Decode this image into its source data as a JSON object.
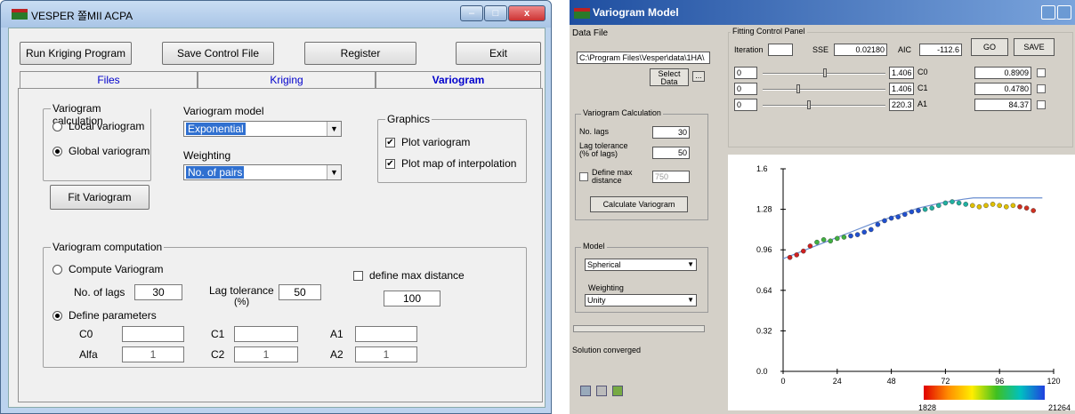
{
  "left_window": {
    "title": "VESPER 쫄MII ACPA",
    "title_controls": {
      "minimize": "–",
      "maximize": "□",
      "close": "x"
    },
    "toolbar": {
      "run_label": "Run Kriging Program",
      "save_label": "Save Control File",
      "register_label": "Register",
      "exit_label": "Exit"
    },
    "tabs": [
      {
        "label": "Files",
        "active": false
      },
      {
        "label": "Kriging",
        "active": false
      },
      {
        "label": "Variogram",
        "active": true
      }
    ],
    "variogram_calc": {
      "legend": "Variogram calculation",
      "local_label": "Local variogram",
      "global_label": "Global variogram",
      "selected": "global"
    },
    "model": {
      "label": "Variogram model",
      "value": "Exponential"
    },
    "weighting": {
      "label": "Weighting",
      "value": "No. of pairs"
    },
    "graphics": {
      "legend": "Graphics",
      "plot_variogram": "Plot variogram",
      "plot_map": "Plot map of interpolation",
      "plot_variogram_checked": true,
      "plot_map_checked": true
    },
    "fit_label": "Fit Variogram",
    "computation": {
      "legend": "Variogram computation",
      "compute_label": "Compute Variogram",
      "nlags_label": "No. of lags",
      "nlags_value": "30",
      "lagtol_label": "Lag tolerance",
      "lagtol_unit": "(%)",
      "lagtol_value": "50",
      "maxdist_label": "define max distance",
      "maxdist_value": "100",
      "define_label": "Define parameters",
      "selected": "define",
      "c0_label": "C0",
      "c0_value": "",
      "c1_label": "C1",
      "c1_value": "",
      "a1_label": "A1",
      "a1_value": "",
      "alfa_label": "Alfa",
      "alfa_value": "1",
      "c2_label": "C2",
      "c2_value": "1",
      "a2_label": "A2",
      "a2_value": "1"
    }
  },
  "right_window": {
    "title": "Variogram Model",
    "data_file": {
      "label": "Data File",
      "path": "C:\\Program Files\\Vesper\\data\\1HA\\",
      "select_label": "Select Data",
      "browse_label": "..."
    },
    "fitting": {
      "legend": "Fitting Control Panel",
      "iteration_label": "Iteration",
      "iteration_value": "",
      "sse_label": "SSE",
      "sse_value": "0.02180",
      "aic_label": "AIC",
      "aic_value": "-112.6",
      "go_label": "GO",
      "save_label": "SAVE",
      "rows": [
        {
          "min": "0",
          "max": "1.406",
          "name": "C0",
          "value": "0.8909",
          "slider": 0.52
        },
        {
          "min": "0",
          "max": "1.406",
          "name": "C1",
          "value": "0.4780",
          "slider": 0.28
        },
        {
          "min": "0",
          "max": "220.3",
          "name": "A1",
          "value": "84.37",
          "slider": 0.38
        }
      ]
    },
    "calc": {
      "legend": "Variogram Calculation",
      "nlags_label": "No. lags",
      "nlags_value": "30",
      "lagtol_label": "Lag tolerance (% of lags)",
      "lagtol_value": "50",
      "maxdist_label": "Define max distance",
      "maxdist_value": "750",
      "calc_label": "Calculate Variogram"
    },
    "model": {
      "legend": "Model",
      "model_value": "Spherical",
      "weighting_label": "Weighting",
      "weighting_value": "Unity"
    },
    "status": "Solution converged",
    "colorbar": {
      "min_label": "1828",
      "max_label": "21264"
    }
  },
  "chart_data": {
    "type": "scatter",
    "title": "",
    "xlabel": "",
    "ylabel": "",
    "xlim": [
      0,
      120
    ],
    "ylim": [
      0,
      1.6
    ],
    "x_ticks": [
      "0",
      "24",
      "48",
      "72",
      "96",
      "120"
    ],
    "y_ticks": [
      "0.0",
      "0.32",
      "0.64",
      "0.96",
      "1.28",
      "1.6"
    ],
    "series": [
      {
        "type": "scatter",
        "x": [
          3,
          6,
          9,
          12,
          15,
          18,
          21,
          24,
          27,
          30,
          33,
          36,
          39,
          42,
          45,
          48,
          51,
          54,
          57,
          60,
          63,
          66,
          69,
          72,
          75,
          78,
          81,
          84,
          87,
          90,
          93,
          96,
          99,
          102,
          105,
          108,
          111
        ],
        "y": [
          0.9,
          0.92,
          0.95,
          0.99,
          1.02,
          1.04,
          1.03,
          1.05,
          1.06,
          1.07,
          1.08,
          1.1,
          1.12,
          1.16,
          1.19,
          1.21,
          1.22,
          1.24,
          1.26,
          1.27,
          1.28,
          1.29,
          1.31,
          1.33,
          1.34,
          1.33,
          1.32,
          1.31,
          1.3,
          1.31,
          1.32,
          1.31,
          1.3,
          1.31,
          1.3,
          1.29,
          1.27
        ]
      },
      {
        "type": "line",
        "x": [
          0,
          10,
          20,
          30,
          40,
          50,
          60,
          70,
          80,
          84.37,
          100,
          115
        ],
        "y": [
          0.89,
          0.96,
          1.03,
          1.1,
          1.17,
          1.23,
          1.29,
          1.33,
          1.36,
          1.37,
          1.37,
          1.37
        ]
      }
    ]
  }
}
